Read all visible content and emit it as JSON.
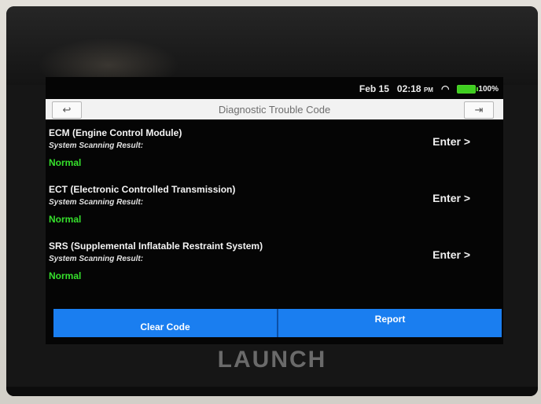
{
  "status": {
    "date": "Feb 15",
    "time": "02:18",
    "meridiem": "PM",
    "battery": "100%",
    "wifi_icon": "wifi-icon"
  },
  "header": {
    "title": "Diagnostic Trouble Code",
    "back_icon": "↩",
    "exit_icon": "⇥"
  },
  "systems": [
    {
      "name": "ECM (Engine Control Module)",
      "sublabel": "System Scanning Result:",
      "status": "Normal",
      "action": "Enter >"
    },
    {
      "name": "ECT (Electronic Controlled Transmission)",
      "sublabel": "System Scanning Result:",
      "status": "Normal",
      "action": "Enter >"
    },
    {
      "name": "SRS (Supplemental Inflatable Restraint System)",
      "sublabel": "System Scanning Result:",
      "status": "Normal",
      "action": "Enter >"
    }
  ],
  "footer": {
    "clear_label": "Clear Code",
    "report_label": "Report"
  },
  "brand": "LAUNCH",
  "colors": {
    "accent": "#1a7ef0",
    "status_ok": "#36e02c",
    "battery": "#3fcf20"
  }
}
